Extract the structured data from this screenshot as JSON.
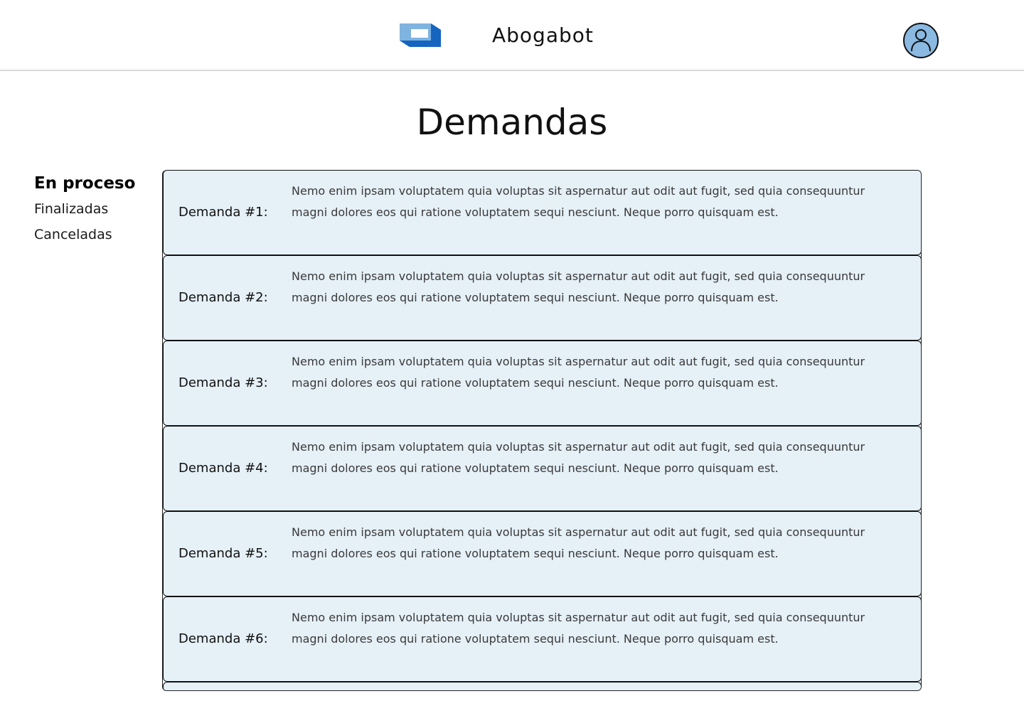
{
  "header": {
    "app_name": "Abogabot",
    "logo_icon": "logo-icon",
    "profile_icon": "user-avatar-icon"
  },
  "colors": {
    "logo_light": "#7fb3e0",
    "logo_dark": "#1565c0",
    "avatar_fill": "#8ab9e2",
    "row_background": "#e5f0f7"
  },
  "page": {
    "title": "Demandas"
  },
  "sidebar": {
    "items": [
      {
        "label": "En proceso",
        "active": true
      },
      {
        "label": "Finalizadas",
        "active": false
      },
      {
        "label": "Canceladas",
        "active": false
      }
    ]
  },
  "demandas": [
    {
      "label": "Demanda #1:",
      "description": "Nemo enim ipsam voluptatem quia voluptas sit aspernatur aut odit aut fugit, sed quia consequuntur magni dolores eos qui ratione voluptatem sequi nesciunt. Neque porro quisquam est."
    },
    {
      "label": "Demanda #2:",
      "description": "Nemo enim ipsam voluptatem quia voluptas sit aspernatur aut odit aut fugit, sed quia consequuntur magni dolores eos qui ratione voluptatem sequi nesciunt. Neque porro quisquam est."
    },
    {
      "label": "Demanda #3:",
      "description": "Nemo enim ipsam voluptatem quia voluptas sit aspernatur aut odit aut fugit, sed quia consequuntur magni dolores eos qui ratione voluptatem sequi nesciunt. Neque porro quisquam est."
    },
    {
      "label": "Demanda #4:",
      "description": "Nemo enim ipsam voluptatem quia voluptas sit aspernatur aut odit aut fugit, sed quia consequuntur magni dolores eos qui ratione voluptatem sequi nesciunt. Neque porro quisquam est."
    },
    {
      "label": "Demanda #5:",
      "description": "Nemo enim ipsam voluptatem quia voluptas sit aspernatur aut odit aut fugit, sed quia consequuntur magni dolores eos qui ratione voluptatem sequi nesciunt. Neque porro quisquam est."
    },
    {
      "label": "Demanda #6:",
      "description": "Nemo enim ipsam voluptatem quia voluptas sit aspernatur aut odit aut fugit, sed quia consequuntur magni dolores eos qui ratione voluptatem sequi nesciunt. Neque porro quisquam est."
    }
  ]
}
